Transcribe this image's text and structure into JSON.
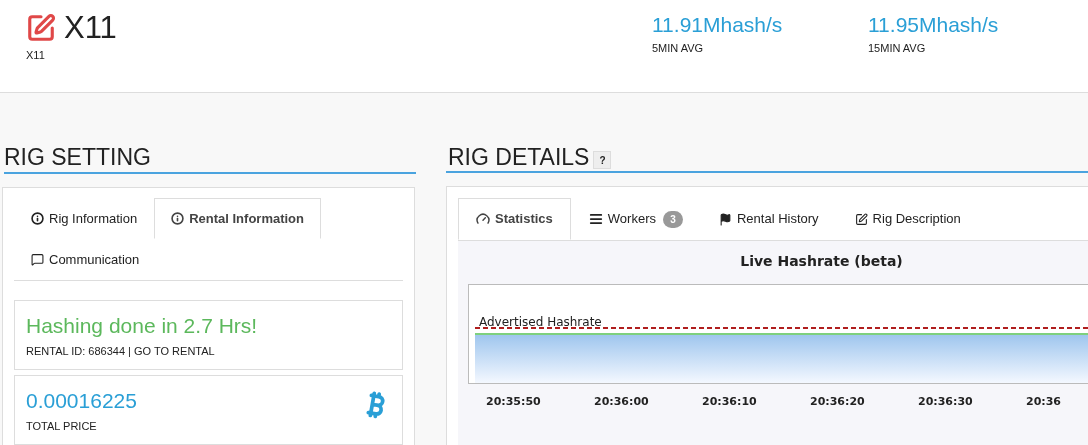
{
  "header": {
    "title": "X11",
    "subtitle": "X11",
    "stats": [
      {
        "value": "11.91Mhash/s",
        "label": "5MIN AVG"
      },
      {
        "value": "11.95Mhash/s",
        "label": "15MIN AVG"
      }
    ]
  },
  "rig_setting": {
    "heading": "RIG SETTING",
    "tabs": [
      {
        "label": "Rig Information",
        "selected": false
      },
      {
        "label": "Rental Information",
        "selected": true
      },
      {
        "label": "Communication",
        "selected": false
      }
    ],
    "status": {
      "message": "Hashing done in 2.7 Hrs!",
      "rental_id": "RENTAL ID: 686344 | GO TO RENTAL"
    },
    "price": {
      "value": "0.00016225",
      "label": "TOTAL PRICE"
    }
  },
  "rig_details": {
    "heading": "RIG DETAILS",
    "help": "?",
    "tabs": [
      {
        "label": "Statistics",
        "selected": true
      },
      {
        "label": "Workers",
        "badge": "3",
        "selected": false
      },
      {
        "label": "Rental History",
        "selected": false
      },
      {
        "label": "Rig Description",
        "selected": false
      }
    ],
    "chart": {
      "title": "Live Hashrate (beta)",
      "line_label": "Advertised Hashrate",
      "x_labels": [
        "20:35:50",
        "20:36:00",
        "20:36:10",
        "20:36:20",
        "20:36:30",
        "20:36"
      ]
    }
  }
}
